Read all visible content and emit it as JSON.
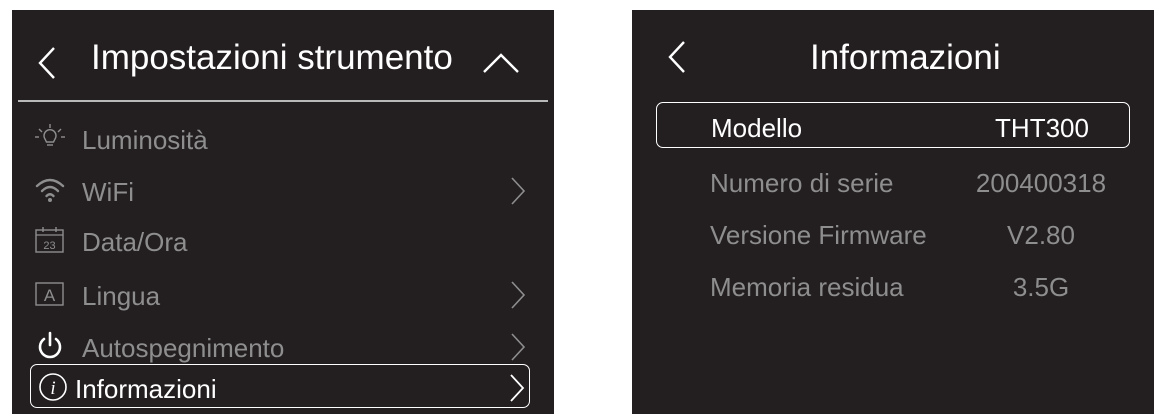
{
  "left_panel": {
    "title": "Impostazioni strumento",
    "items": [
      {
        "label": "Luminosità",
        "icon": "brightness-icon",
        "has_chevron": false
      },
      {
        "label": "WiFi",
        "icon": "wifi-icon",
        "has_chevron": true
      },
      {
        "label": "Data/Ora",
        "icon": "calendar-icon",
        "icon_text": "23",
        "has_chevron": false
      },
      {
        "label": "Lingua",
        "icon": "language-icon",
        "icon_text": "A",
        "has_chevron": true
      },
      {
        "label": "Autospegnimento",
        "icon": "power-icon",
        "has_chevron": true
      },
      {
        "label": "Informazioni",
        "icon": "info-icon",
        "icon_text": "i",
        "has_chevron": true,
        "selected": true
      }
    ]
  },
  "right_panel": {
    "title": "Informazioni",
    "rows": [
      {
        "key": "Modello",
        "value": "THT300",
        "selected": true
      },
      {
        "key": "Numero di serie",
        "value": "200400318"
      },
      {
        "key": "Versione Firmware",
        "value": "V2.80"
      },
      {
        "key": "Memoria residua",
        "value": "3.5G"
      }
    ]
  },
  "colors": {
    "screen_bg": "#231f20",
    "text_active": "#ffffff",
    "text_inactive": "#8e8e8e",
    "divider": "#b9b9b9"
  }
}
